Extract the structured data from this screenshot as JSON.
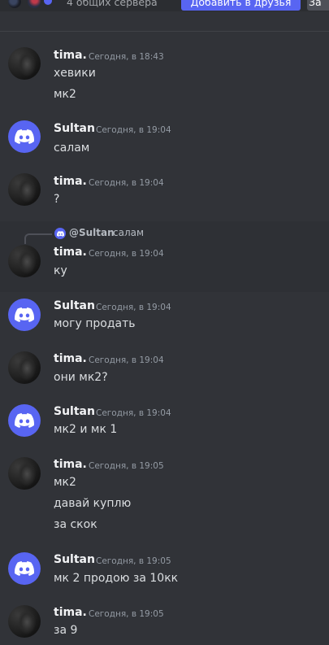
{
  "header": {
    "mutual_servers": "4 общих сервера",
    "add_friend_label": "Добавить в друзья",
    "more_label": "За"
  },
  "messages": [
    {
      "author": "tima.",
      "timestamp": "Сегодня, в 18:43",
      "avatar": "tima-avatar",
      "lines": [
        "хевики",
        "мк2"
      ]
    },
    {
      "author": "Sultan",
      "timestamp": "Сегодня, в 19:04",
      "avatar": "discord-logo-icon",
      "lines": [
        "салам"
      ]
    },
    {
      "author": "tima.",
      "timestamp": "Сегодня, в 19:04",
      "avatar": "tima-avatar",
      "lines": [
        "?"
      ]
    },
    {
      "author": "tima.",
      "timestamp": "Сегодня, в 19:04",
      "avatar": "tima-avatar",
      "lines": [
        "ку"
      ],
      "reply": {
        "author": "@Sultan",
        "text": "салам"
      }
    },
    {
      "author": "Sultan",
      "timestamp": "Сегодня, в 19:04",
      "avatar": "discord-logo-icon",
      "lines": [
        "могу продать"
      ]
    },
    {
      "author": "tima.",
      "timestamp": "Сегодня, в 19:04",
      "avatar": "tima-avatar",
      "lines": [
        "они мк2?"
      ]
    },
    {
      "author": "Sultan",
      "timestamp": "Сегодня, в 19:04",
      "avatar": "discord-logo-icon",
      "lines": [
        "мк2 и мк 1"
      ]
    },
    {
      "author": "tima.",
      "timestamp": "Сегодня, в 19:05",
      "avatar": "tima-avatar",
      "lines": [
        "мк2",
        "давай куплю",
        "за скок"
      ]
    },
    {
      "author": "Sultan",
      "timestamp": "Сегодня, в 19:05",
      "avatar": "discord-logo-icon",
      "lines": [
        "мк 2 продою за 10кк"
      ]
    },
    {
      "author": "tima.",
      "timestamp": "Сегодня, в 19:05",
      "avatar": "tima-avatar",
      "lines": [
        "за 9"
      ]
    }
  ]
}
